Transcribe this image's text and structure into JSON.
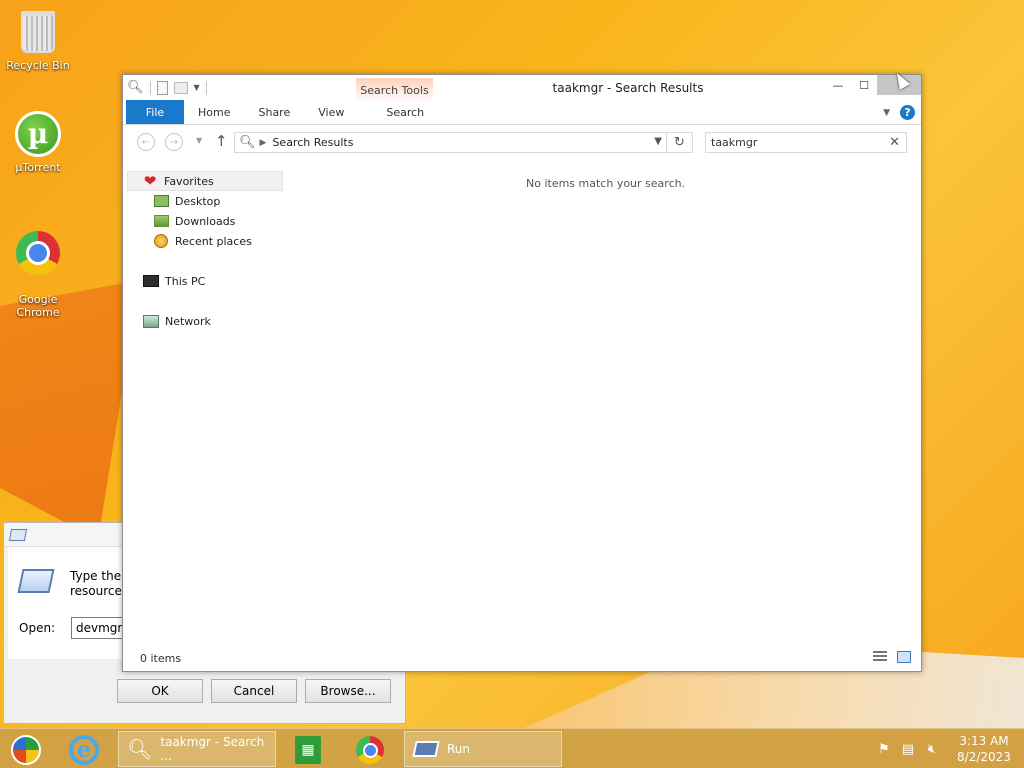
{
  "desktop": {
    "icons": [
      {
        "label": "Recycle Bin",
        "icon": "recycle-bin-icon"
      },
      {
        "label": "µTorrent",
        "icon": "utorrent-icon"
      },
      {
        "label": "Google\nChrome",
        "icon": "chrome-icon"
      }
    ]
  },
  "run_dialog": {
    "description": "Type the r\nresource, a",
    "open_label": "Open:",
    "open_value": "devmgm",
    "ok_label": "OK",
    "cancel_label": "Cancel",
    "browse_label": "Browse..."
  },
  "explorer": {
    "title": "taakmgr - Search Results",
    "contextual_tab": "Search Tools",
    "ribbon_tabs": [
      "File",
      "Home",
      "Share",
      "View",
      "Search"
    ],
    "help_glyph": "?",
    "address": "Search Results",
    "search_value": "taakmgr",
    "nav": {
      "favorites": "Favorites",
      "desktop": "Desktop",
      "downloads": "Downloads",
      "recent": "Recent places",
      "this_pc": "This PC",
      "network": "Network"
    },
    "empty_message": "No items match your search.",
    "status_count": "0 items"
  },
  "taskbar": {
    "search_window_label": "taakmgr - Search ...",
    "run_label": "Run",
    "clock_time": "3:13 AM",
    "clock_date": "8/2/2023"
  },
  "colors": {
    "accent": "#1979ca",
    "desktop_background": "#f9b51c",
    "contextual_tab": "#fcd2bb"
  }
}
